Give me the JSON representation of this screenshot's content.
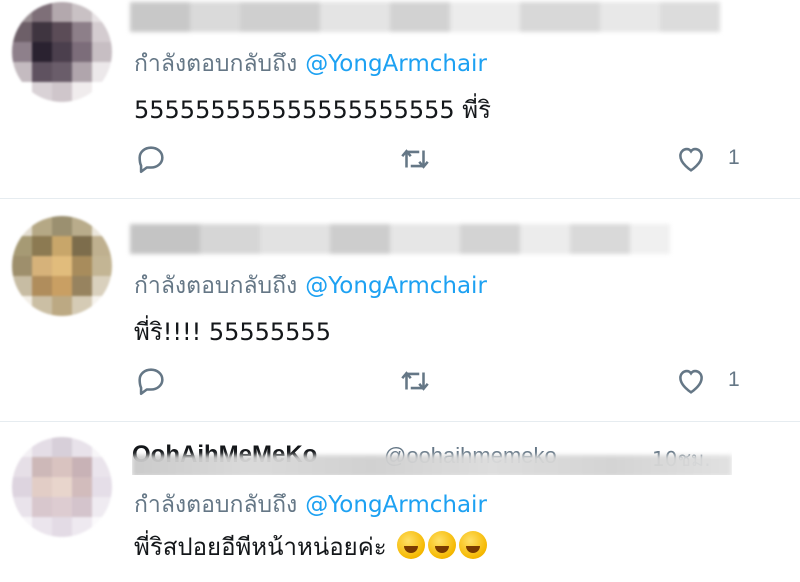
{
  "tweets": [
    {
      "reply_prefix": "กำลังตอบกลับถึง",
      "mention": "@YongArmchair",
      "text": "555555555555555555555 พี่ริ",
      "like_count": "1"
    },
    {
      "reply_prefix": "กำลังตอบกลับถึง",
      "mention": "@YongArmchair",
      "text": "พี่ริ!!!! 55555555",
      "like_count": "1"
    },
    {
      "display_name": "OohAihMeMeKo",
      "handle": "@oohaihmemeko",
      "time": "10ชม.",
      "reply_prefix": "กำลังตอบกลับถึง",
      "mention": "@YongArmchair",
      "text": "พี่ริสปอยอีพีหน้าหน่อยค่ะ",
      "emojis": [
        "rolling-on-floor-laughing",
        "rolling-on-floor-laughing",
        "grinning-squinting-face"
      ]
    }
  ],
  "colors": {
    "mention": "#1da1f2",
    "secondary_text": "#657786",
    "primary_text": "#14171a",
    "divider": "#e6ecf0"
  },
  "icons": {
    "reply": "reply-icon",
    "retweet": "retweet-icon",
    "like": "heart-icon"
  }
}
